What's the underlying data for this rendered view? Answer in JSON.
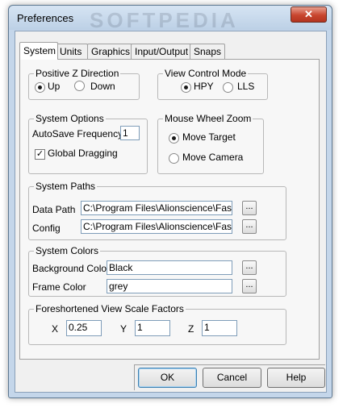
{
  "window": {
    "title": "Preferences",
    "watermark": "SOFTPEDIA",
    "close_glyph": "✕"
  },
  "tabs": [
    {
      "label": "System",
      "active": true
    },
    {
      "label": "Units",
      "active": false
    },
    {
      "label": "Graphics",
      "active": false
    },
    {
      "label": "Input/Output",
      "active": false
    },
    {
      "label": "Snaps",
      "active": false
    }
  ],
  "positive_z": {
    "title": "Positive Z Direction",
    "up": "Up",
    "down": "Down",
    "selected": "Up"
  },
  "view_control": {
    "title": "View Control Mode",
    "hpy": "HPY",
    "lls": "LLS",
    "selected": "HPY"
  },
  "system_options": {
    "title": "System Options",
    "autosave_label": "AutoSave Frequency",
    "autosave_value": "1",
    "global_dragging_label": "Global Dragging",
    "global_dragging_checked": true
  },
  "mouse_wheel": {
    "title": "Mouse Wheel Zoom",
    "move_target": "Move Target",
    "move_camera": "Move Camera",
    "selected": "Move Target"
  },
  "system_paths": {
    "title": "System Paths",
    "data_path_label": "Data Path",
    "data_path_value": "C:\\Program Files\\Alionscience\\FastShi",
    "config_label": "Config",
    "config_value": "C:\\Program Files\\Alionscience\\FastShi",
    "browse_label": "..."
  },
  "system_colors": {
    "title": "System Colors",
    "background_label": "Background Color",
    "background_value": "Black",
    "frame_label": "Frame Color",
    "frame_value": "grey",
    "browse_label": "..."
  },
  "scale_factors": {
    "title": "Foreshortened View Scale Factors",
    "x_label": "X",
    "x_value": "0.25",
    "y_label": "Y",
    "y_value": "1",
    "z_label": "Z",
    "z_value": "1"
  },
  "buttons": {
    "ok": "OK",
    "cancel": "Cancel",
    "help": "Help"
  }
}
